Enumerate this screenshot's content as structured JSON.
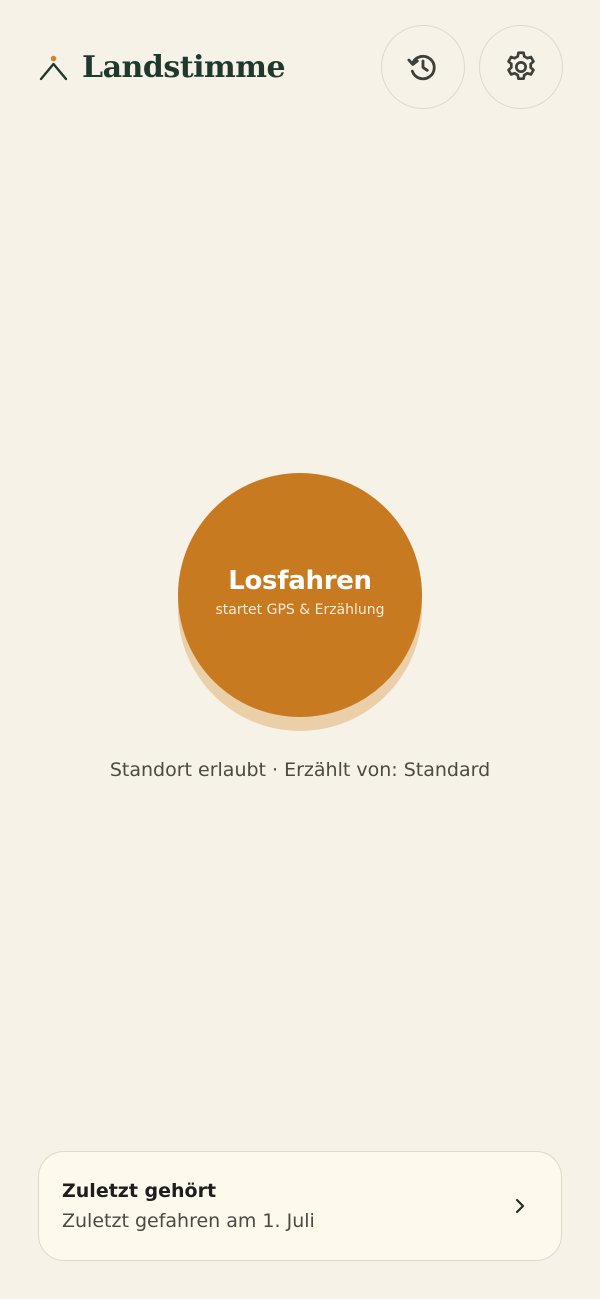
{
  "header": {
    "app_name": "Landstimme",
    "logo_icon": "landstimme-logo-icon",
    "history_icon": "history-icon",
    "settings_icon": "gear-icon"
  },
  "main": {
    "start_button": {
      "label": "Losfahren",
      "sublabel": "startet GPS & Erzählung"
    },
    "status_text": "Standort erlaubt · Erzählt von: Standard"
  },
  "recent": {
    "title": "Zuletzt gehört",
    "subtitle": "Zuletzt gefahren am 1. Juli",
    "chevron_icon": "chevron-right-icon"
  },
  "colors": {
    "background": "#F6F2E8",
    "accent": "#C77A20",
    "accent_shadow": "#EBCFA9",
    "brand_text": "#1F3A2C",
    "card_background": "#FDF9ED",
    "border": "#E0D9CA"
  }
}
